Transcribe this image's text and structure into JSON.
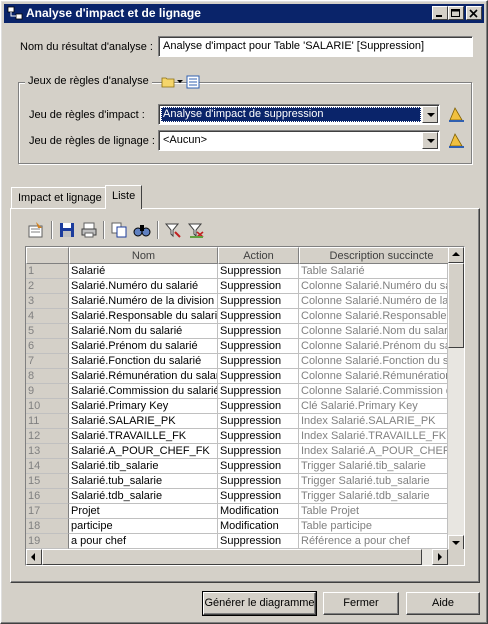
{
  "window": {
    "title": "Analyse d'impact et de lignage"
  },
  "result_name": {
    "label": "Nom du résultat d'analyse :",
    "value": "Analyse d'impact pour Table 'SALARIE' [Suppression]"
  },
  "rule_sets": {
    "group_label": "Jeux de règles d'analyse",
    "impact_label": "Jeu de règles d'impact :",
    "impact_value": "Analyse d'impact de suppression",
    "lineage_label": "Jeu de règles de lignage :",
    "lineage_value": "<Aucun>"
  },
  "tabs": [
    {
      "label": "Impact et lignage",
      "active": false
    },
    {
      "label": "Liste",
      "active": true
    }
  ],
  "toolbar": {
    "icons": [
      "properties-icon",
      "save-icon",
      "print-icon",
      "copy-icon",
      "find-icon",
      "filter-icon",
      "clear-filter-icon"
    ]
  },
  "grid": {
    "columns": [
      "",
      "Nom",
      "Action",
      "Description succincte"
    ],
    "rows": [
      {
        "n": "1",
        "nom": "Salarié",
        "action": "Suppression",
        "desc": "Table Salarié"
      },
      {
        "n": "2",
        "nom": "Salarié.Numéro du salarié",
        "action": "Suppression",
        "desc": "Colonne Salarié.Numéro du salarié"
      },
      {
        "n": "3",
        "nom": "Salarié.Numéro de la division",
        "action": "Suppression",
        "desc": "Colonne Salarié.Numéro de la division"
      },
      {
        "n": "4",
        "nom": "Salarié.Responsable du salarié",
        "action": "Suppression",
        "desc": "Colonne Salarié.Responsable du salarié"
      },
      {
        "n": "5",
        "nom": "Salarié.Nom du salarié",
        "action": "Suppression",
        "desc": "Colonne Salarié.Nom du salarié"
      },
      {
        "n": "6",
        "nom": "Salarié.Prénom du salarié",
        "action": "Suppression",
        "desc": "Colonne Salarié.Prénom du salarié"
      },
      {
        "n": "7",
        "nom": "Salarié.Fonction du salarié",
        "action": "Suppression",
        "desc": "Colonne Salarié.Fonction du salarié"
      },
      {
        "n": "8",
        "nom": "Salarié.Rémunération du salarié",
        "action": "Suppression",
        "desc": "Colonne Salarié.Rémunération"
      },
      {
        "n": "9",
        "nom": "Salarié.Commission du salarié",
        "action": "Suppression",
        "desc": "Colonne Salarié.Commission du salarié"
      },
      {
        "n": "10",
        "nom": "Salarié.Primary Key",
        "action": "Suppression",
        "desc": "Clé Salarié.Primary Key"
      },
      {
        "n": "11",
        "nom": "Salarié.SALARIE_PK",
        "action": "Suppression",
        "desc": "Index Salarié.SALARIE_PK"
      },
      {
        "n": "12",
        "nom": "Salarié.TRAVAILLE_FK",
        "action": "Suppression",
        "desc": "Index Salarié.TRAVAILLE_FK"
      },
      {
        "n": "13",
        "nom": "Salarié.A_POUR_CHEF_FK",
        "action": "Suppression",
        "desc": "Index Salarié.A_POUR_CHEF_FK"
      },
      {
        "n": "14",
        "nom": "Salarié.tib_salarie",
        "action": "Suppression",
        "desc": "Trigger Salarié.tib_salarie"
      },
      {
        "n": "15",
        "nom": "Salarié.tub_salarie",
        "action": "Suppression",
        "desc": "Trigger Salarié.tub_salarie"
      },
      {
        "n": "16",
        "nom": "Salarié.tdb_salarie",
        "action": "Suppression",
        "desc": "Trigger Salarié.tdb_salarie"
      },
      {
        "n": "17",
        "nom": "Projet",
        "action": "Modification",
        "desc": "Table Projet"
      },
      {
        "n": "18",
        "nom": "participe",
        "action": "Modification",
        "desc": "Table participe"
      },
      {
        "n": "19",
        "nom": "a pour chef",
        "action": "Suppression",
        "desc": "Référence a pour chef"
      }
    ]
  },
  "buttons": {
    "generate": "Générer le diagramme",
    "close": "Fermer",
    "help": "Aide"
  },
  "colors": {
    "face": "#d4d0c8",
    "title_bar": "#0a246a",
    "selection": "#0a246a"
  }
}
